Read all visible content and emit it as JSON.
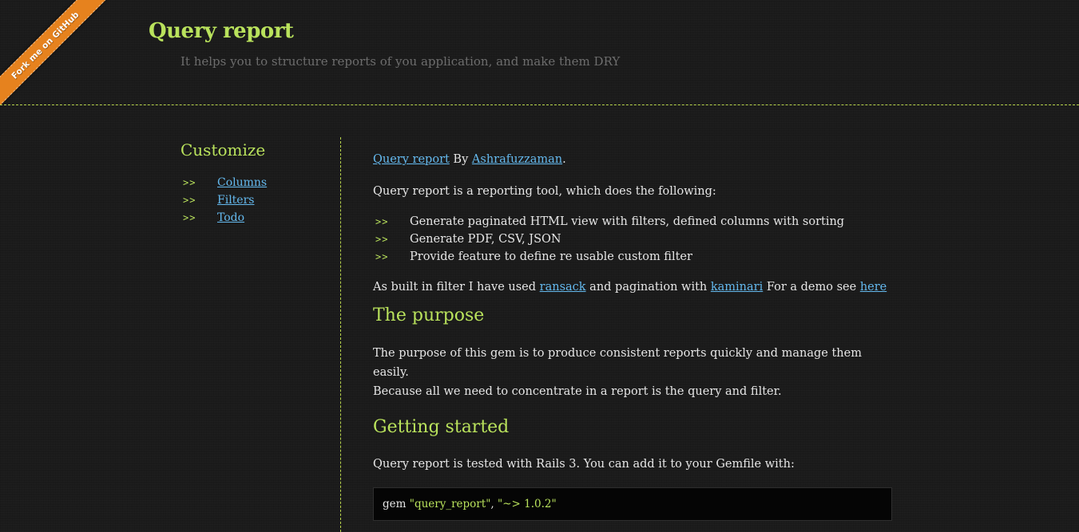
{
  "ribbon": {
    "label": "Fork me on GitHub"
  },
  "header": {
    "title": "Query report",
    "subtitle": "It helps you to structure reports of you application, and make them DRY"
  },
  "sidebar": {
    "title": "Customize",
    "bullet": ">>",
    "items": [
      {
        "label": "Columns"
      },
      {
        "label": "Filters"
      },
      {
        "label": "Todo"
      }
    ]
  },
  "main": {
    "intro": {
      "project_link": "Query report",
      "by": " By ",
      "author_link": "Ashrafuzzaman",
      "end": "."
    },
    "description": "Query report is a reporting tool, which does the following:",
    "features": [
      {
        "text": "Generate paginated HTML view with filters, defined columns with sorting"
      },
      {
        "text": "Generate PDF, CSV, JSON"
      },
      {
        "text": "Provide feature to define re usable custom filter"
      }
    ],
    "built_in": {
      "text1": "As built in filter I have used ",
      "ransack_link": "ransack",
      "text2": " and pagination with ",
      "kaminari_link": "kaminari",
      "text3": " For a demo see ",
      "here_link": "here"
    },
    "purpose": {
      "title": "The purpose",
      "line1": "The purpose of this gem is to produce consistent reports quickly and manage them easily.",
      "line2": "Because all we need to concentrate in a report is the query and filter."
    },
    "getting_started": {
      "title": "Getting started",
      "text": "Query report is tested with Rails 3. You can add it to your Gemfile with:",
      "code_keyword": "gem ",
      "code_string": "\"query_report\"",
      "code_sep": ", ",
      "code_version": "\"~> 1.0.2\""
    }
  },
  "colors": {
    "accent_green": "#b9e25c",
    "link_blue": "#64b9ee",
    "ribbon_orange": "#e6821e",
    "background": "#1b1b1b"
  }
}
